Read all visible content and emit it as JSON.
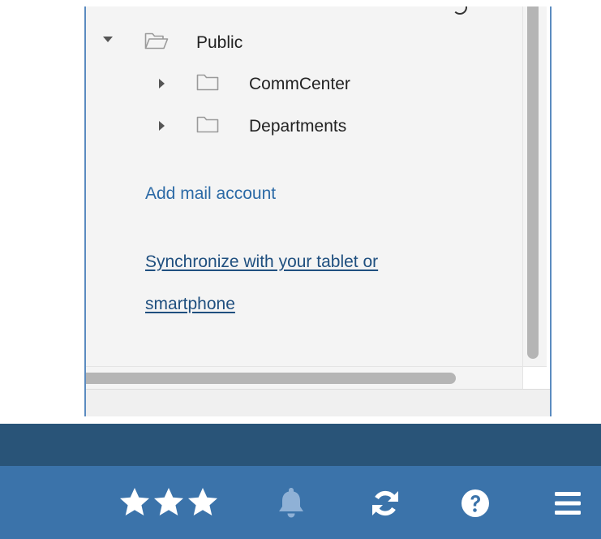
{
  "folder_tree": {
    "items": [
      {
        "label": "Public",
        "expanded": true,
        "icon": "folder-open-icon",
        "level": 0
      },
      {
        "label": "CommCenter",
        "expanded": false,
        "icon": "folder-icon",
        "level": 1
      },
      {
        "label": "Departments",
        "expanded": false,
        "icon": "folder-icon",
        "level": 1
      }
    ]
  },
  "links": {
    "add_mail_account": "Add mail account",
    "sync_line1": "Synchronize with your tablet or",
    "sync_line2": "smartphone"
  },
  "toolbar": {
    "favorites": {
      "icon": "three-stars-icon",
      "stars": 3
    },
    "notifications": {
      "icon": "bell-icon",
      "state": "disabled"
    },
    "refresh": {
      "icon": "refresh-icon"
    },
    "help": {
      "icon": "help-icon"
    },
    "menu": {
      "icon": "hamburger-menu-icon"
    }
  },
  "colors": {
    "link": "#2c6aa6",
    "link_underlined": "#1f4f7f",
    "topbar": "#295478",
    "toolbar": "#3b73aa",
    "panel_border": "#5b8bc0",
    "bell_disabled": "#8fb1d6"
  }
}
